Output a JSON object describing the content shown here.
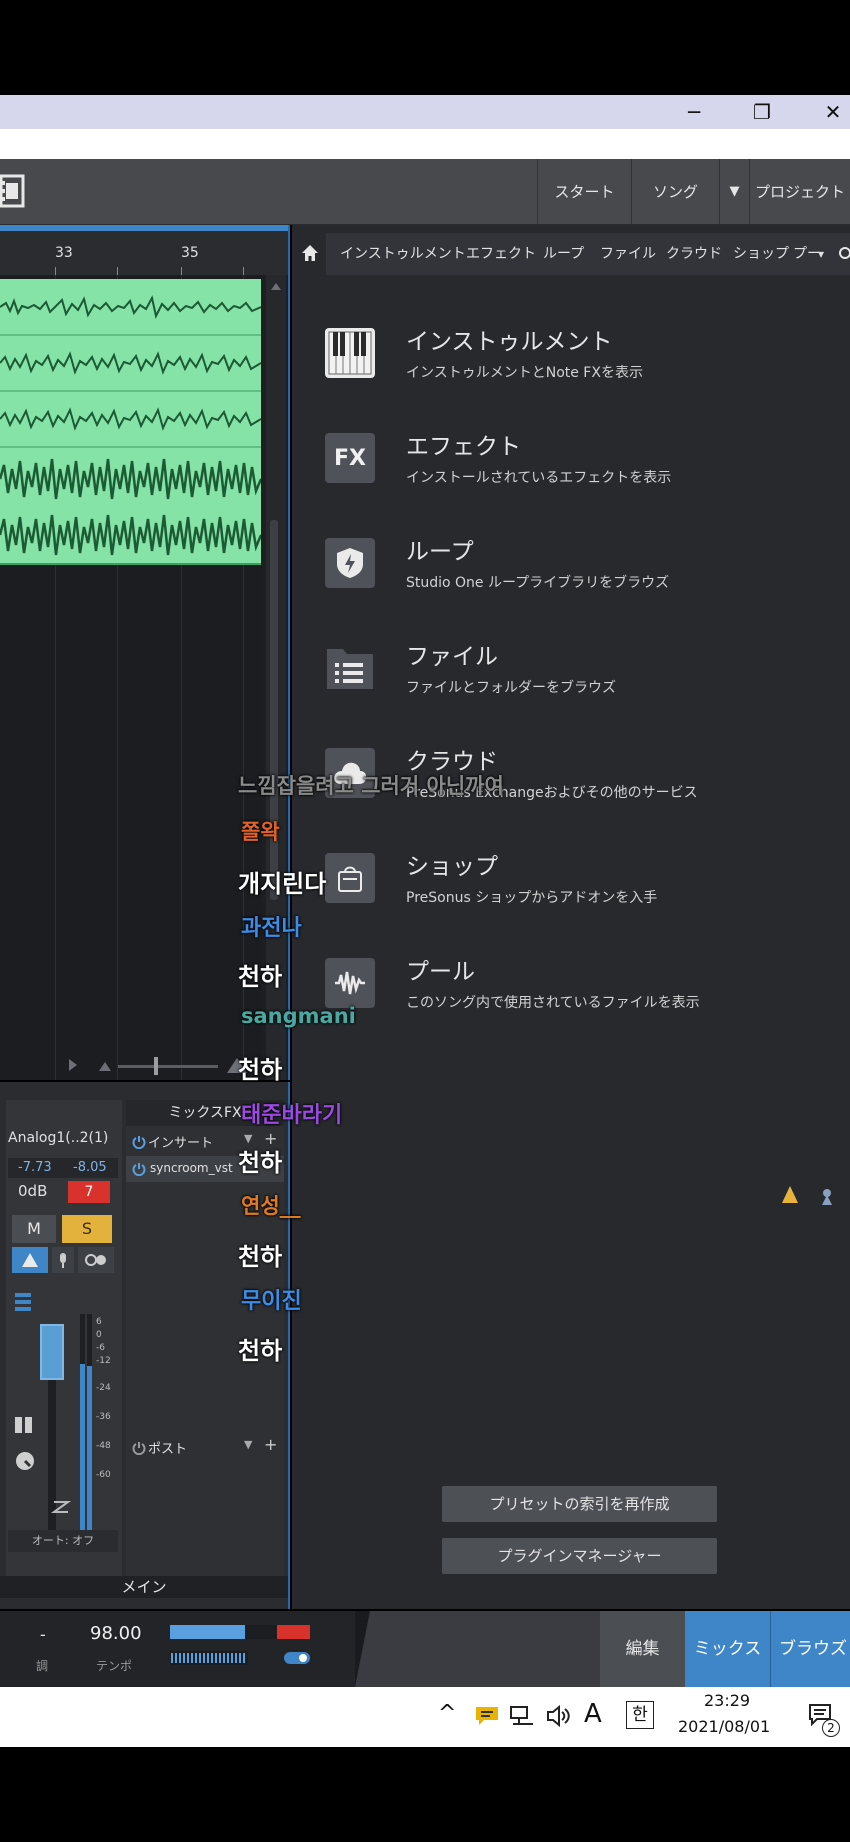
{
  "window": {
    "minimize": "─",
    "restore": "❐",
    "close": "✕"
  },
  "toolbar": {
    "start": "スタート",
    "song": "ソング",
    "dropdown": "▼",
    "project": "プロジェクト"
  },
  "arranger": {
    "ruler": [
      "33",
      "35"
    ]
  },
  "browser": {
    "tabs": [
      "インストゥルメント",
      "エフェクト",
      "ループ",
      "ファイル",
      "クラウド",
      "ショップ",
      "プー"
    ],
    "tab_more": "▾",
    "items": [
      {
        "title": "インストゥルメント",
        "subtitle": "インストゥルメントとNote FXを表示",
        "icon": "piano-keys-icon"
      },
      {
        "title": "エフェクト",
        "subtitle": "インストールされているエフェクトを表示",
        "icon": "fx-icon",
        "icon_text": "FX"
      },
      {
        "title": "ループ",
        "subtitle": "Studio One ループライブラリをブラウズ",
        "icon": "loop-shield-icon"
      },
      {
        "title": "ファイル",
        "subtitle": "ファイルとフォルダーをブラウズ",
        "icon": "folder-icon"
      },
      {
        "title": "クラウド",
        "subtitle": "PreSonus Exchangeおよびその他のサービス",
        "icon": "cloud-icon"
      },
      {
        "title": "ショップ",
        "subtitle": "PreSonus ショップからアドオンを入手",
        "icon": "shop-bag-icon"
      },
      {
        "title": "プール",
        "subtitle": "このソング内で使用されているファイルを表示",
        "icon": "pool-wave-icon"
      }
    ],
    "rebuild_index": "プリセットの索引を再作成",
    "plugin_manager": "プラグインマネージャー"
  },
  "mixer": {
    "channel_name": "Analog1(..2(1)",
    "peak_left": "-7.73",
    "peak_right": "-8.05",
    "gain": "0dB",
    "channel_number": "7",
    "mute": "M",
    "solo": "S",
    "fader_scale": [
      "6",
      "0",
      "-6",
      "-12",
      "-24",
      "-36",
      "-48",
      "-60"
    ],
    "automation": "オート: オフ",
    "mix_fx": "ミックスFX",
    "insert": "インサート",
    "plugin": "syncroom_vst",
    "post": "ポスト",
    "main": "メイン"
  },
  "transport": {
    "key_value": "-",
    "key_label": "調",
    "tempo_value": "98.00",
    "tempo_label": "テンポ",
    "edit": "編集",
    "mix": "ミックス",
    "browse": "ブラウズ"
  },
  "taskbar": {
    "chevron": "^",
    "ime_mode": "A",
    "ime_lang": "한",
    "time": "23:29",
    "date": "2021/08/01",
    "notifications": "2"
  },
  "chat": [
    {
      "text": "느낌잡을려고 그러거 아닌까여",
      "color": "#8a8a8a"
    },
    {
      "text": "쫄왁",
      "color": "#e0622a"
    },
    {
      "text": "개지린다",
      "color": "#ffffff"
    },
    {
      "text": "과전나",
      "color": "#3d8de8"
    },
    {
      "text": "천하",
      "color": "#ffffff"
    },
    {
      "text": "sangmani",
      "color": "#4aa8a0"
    },
    {
      "text": "천하",
      "color": "#ffffff"
    },
    {
      "text": "태준바라기",
      "color": "#9a4ae0"
    },
    {
      "text": "천하",
      "color": "#ffffff"
    },
    {
      "text": "연성__",
      "color": "#e07a22"
    },
    {
      "text": "천하",
      "color": "#ffffff"
    },
    {
      "text": "무이진",
      "color": "#3d8de8"
    },
    {
      "text": "천하",
      "color": "#ffffff"
    }
  ],
  "colors": {
    "accent_blue": "#3f86c9",
    "clip_green": "#86e3a8",
    "solo_yellow": "#e3b23c",
    "record_red": "#d9312b",
    "mix_active": "#3f86c9"
  }
}
